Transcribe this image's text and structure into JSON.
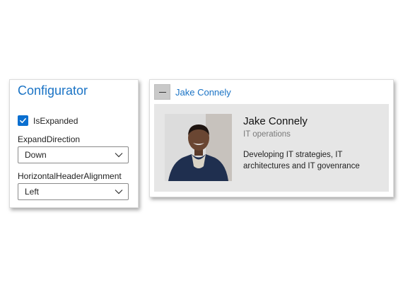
{
  "configurator": {
    "title": "Configurator",
    "is_expanded_label": "IsExpanded",
    "is_expanded_checked": true,
    "expand_direction_label": "ExpandDirection",
    "expand_direction_value": "Down",
    "header_alignment_label": "HorizontalHeaderAlignment",
    "header_alignment_value": "Left"
  },
  "expander": {
    "header": "Jake Connely",
    "expanded": true,
    "content": {
      "name": "Jake Connely",
      "role": "IT operations",
      "description": "Developing IT strategies, IT architectures and IT govenrance"
    }
  },
  "colors": {
    "accent": "#1a73c5",
    "checkbox": "#0a6fd0",
    "content_background": "#e6e6e6"
  },
  "icons": {
    "checkbox": "checkmark-icon",
    "select": "chevron-down-icon",
    "collapse": "minus-icon"
  }
}
